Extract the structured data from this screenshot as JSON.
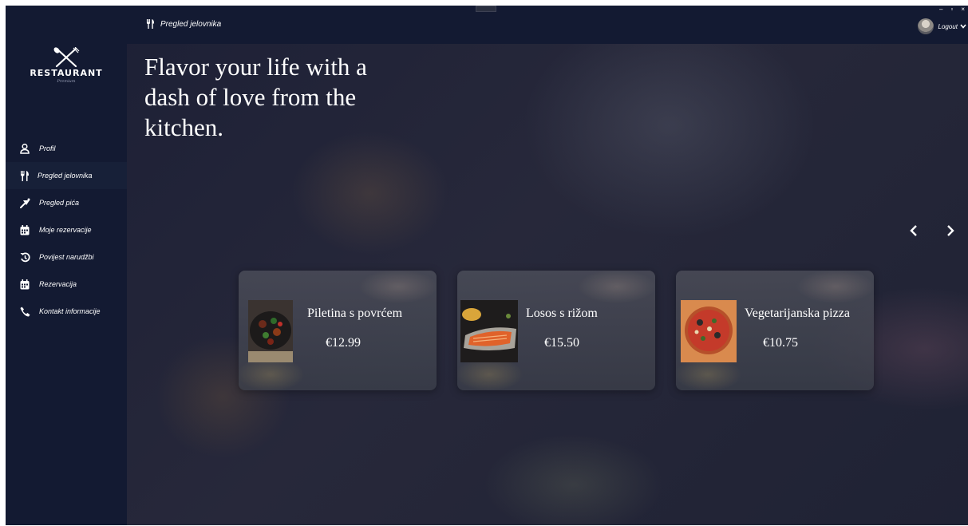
{
  "app": {
    "logo_title": "RESTAURANT",
    "logo_subtitle": "Premium"
  },
  "sidebar": {
    "items": [
      {
        "label": "Profil",
        "icon": "user-icon"
      },
      {
        "label": "Pregled jelovnika",
        "icon": "utensils-icon",
        "active": true
      },
      {
        "label": "Pregled pića",
        "icon": "cocktail-icon"
      },
      {
        "label": "Moje rezervacije",
        "icon": "calendar-icon"
      },
      {
        "label": "Povijest narudžbi",
        "icon": "history-icon"
      },
      {
        "label": "Rezervacija",
        "icon": "calendar-icon"
      },
      {
        "label": "Kontakt informacije",
        "icon": "phone-icon"
      }
    ]
  },
  "topbar": {
    "title": "Pregled jelovnika",
    "user_label": "Logout",
    "window_controls": [
      "–",
      "▫",
      "×"
    ]
  },
  "hero": {
    "headline": "Flavor your life with a dash of love from the kitchen."
  },
  "cards": [
    {
      "name": "Piletina s povrćem",
      "price": "€12.99"
    },
    {
      "name": "Losos s rižom",
      "price": "€15.50"
    },
    {
      "name": "Vegetarijanska pizza",
      "price": "€10.75"
    }
  ],
  "colors": {
    "sidebar_bg": "#131a32",
    "active_item_bg": "#172038",
    "text": "#ffffff"
  }
}
